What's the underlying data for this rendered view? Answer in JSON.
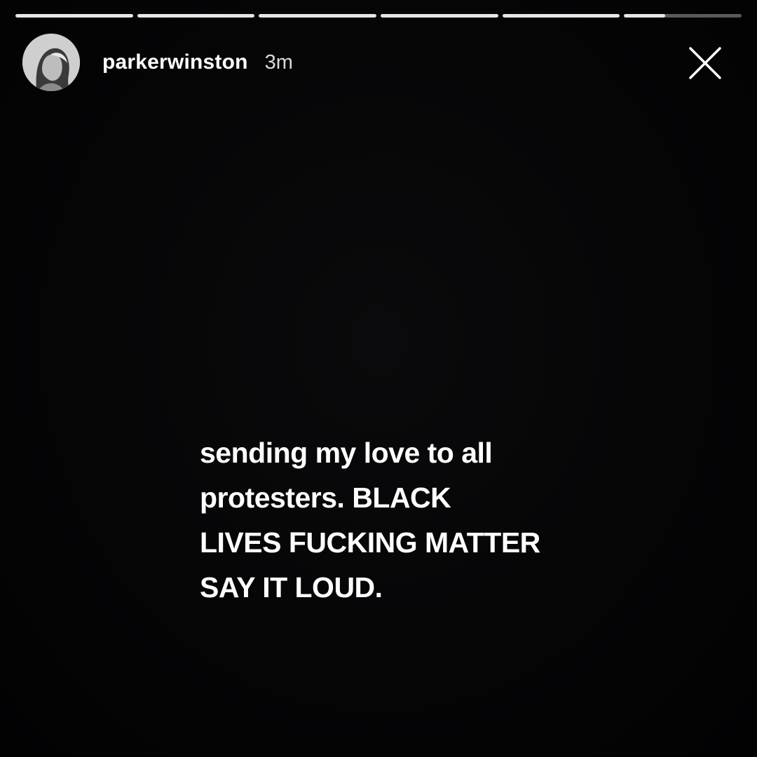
{
  "story": {
    "progress_segments": [
      1,
      1,
      1,
      1,
      1,
      0.35
    ],
    "progress_color": "#e6e6e6",
    "header": {
      "avatar_icon": "profile-photo-avatar",
      "username": "parkerwinston",
      "time_ago": "3m",
      "close_icon": "close-x-icon"
    },
    "message_lines": [
      "sending my love to all",
      "protesters. BLACK",
      "LIVES FUCKING MATTER",
      "SAY IT LOUD."
    ]
  }
}
